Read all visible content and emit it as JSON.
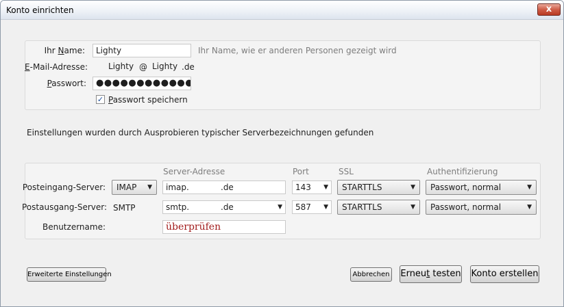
{
  "window": {
    "title": "Konto einrichten",
    "close_glyph": "x"
  },
  "account": {
    "name_label_pre": "Ihr ",
    "name_label_ul": "N",
    "name_label_post": "ame:",
    "name_value": "Lighty",
    "name_hint": "Ihr Name, wie er anderen Personen gezeigt wird",
    "email_label_ul": "E",
    "email_label_post": "-Mail-Adresse:",
    "email_local": "Lighty",
    "email_at": "@",
    "email_domain": "Lighty",
    "email_tld": ".de",
    "password_label_ul": "P",
    "password_label_post": "asswort:",
    "password_value": "●●●●●●●●●●●●●●●●",
    "remember_checked": "✓",
    "remember_label_ul": "P",
    "remember_label_post": "asswort speichern"
  },
  "status_message": "Einstellungen wurden durch Ausprobieren typischer Serverbezeichnungen gefunden",
  "servers": {
    "columns": {
      "address": "Server-Adresse",
      "port": "Port",
      "ssl": "SSL",
      "auth": "Authentifizierung"
    },
    "incoming": {
      "label": "Posteingang-Server:",
      "protocol": "IMAP",
      "host_prefix": "imap.",
      "host_suffix": ".de",
      "port": "143",
      "ssl": "STARTTLS",
      "auth": "Passwort, normal"
    },
    "outgoing": {
      "label": "Postausgang-Server:",
      "protocol": "SMTP",
      "host_prefix": "smtp.",
      "host_suffix": ".de",
      "port": "587",
      "ssl": "STARTTLS",
      "auth": "Passwort, normal"
    },
    "username": {
      "label": "Benutzername:",
      "value": "überprüfen"
    }
  },
  "buttons": {
    "advanced": "Erweiterte Einstellungen",
    "cancel": "Abbrechen",
    "retest_pre": "Erneu",
    "retest_ul": "t",
    "retest_post": " testen",
    "create": "Konto erstellen"
  },
  "icons": {
    "dropdown": "▼",
    "close": "close-icon",
    "checkmark": "check-icon"
  },
  "colors": {
    "error_text": "#a11a1a",
    "close_button": "#c4452d"
  }
}
